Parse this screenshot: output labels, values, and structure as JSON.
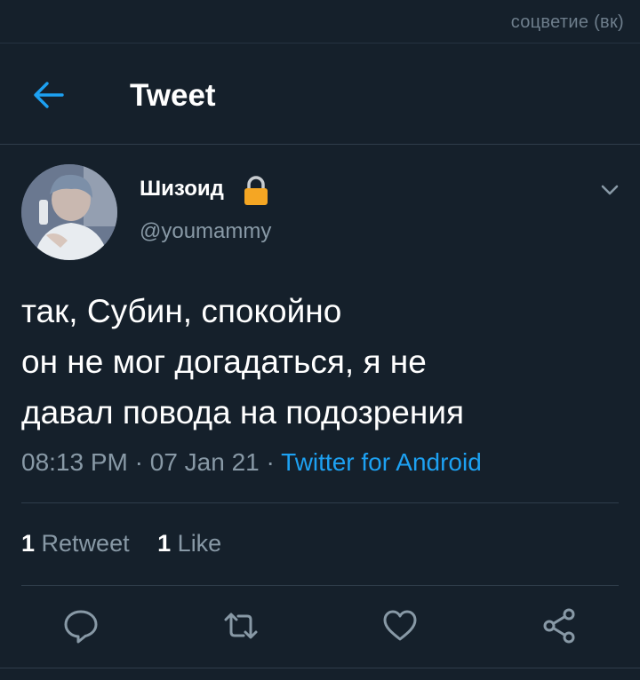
{
  "watermark": "соцветие (вк)",
  "header": {
    "title": "Tweet",
    "back_icon": "arrow-left-icon"
  },
  "tweet": {
    "display_name": "Шизоид",
    "username": "@youmammy",
    "text_lines": [
      "так, Субин, спокойно",
      "он не мог догадаться, я не",
      "давал повода на подозрения"
    ],
    "time": "08:13 PM",
    "date": "07 Jan 21",
    "separator": " · ",
    "source": "Twitter for Android",
    "retweets_count": "1",
    "retweets_label": "Retweet",
    "likes_count": "1",
    "likes_label": "Like"
  },
  "icons": [
    "lock-icon",
    "chevron-down-icon",
    "reply-icon",
    "retweet-icon",
    "like-icon",
    "share-icon"
  ],
  "colors": {
    "background": "#15202b",
    "accent": "#1da1f2",
    "secondary_text": "#8899a6",
    "lock": "#f5a623"
  }
}
